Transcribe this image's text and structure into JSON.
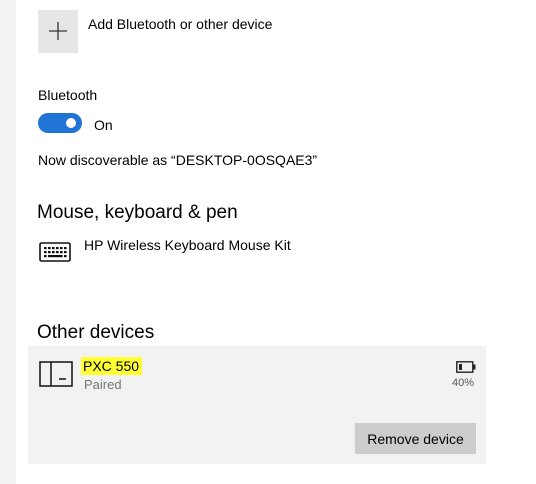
{
  "add_device": {
    "label": "Add Bluetooth or other device",
    "icon": "plus-icon"
  },
  "bluetooth": {
    "heading": "Bluetooth",
    "toggle_state": "On",
    "toggle_on": true,
    "discoverable_text": "Now discoverable as “DESKTOP-0OSQAE3”"
  },
  "mouse_keyboard_pen": {
    "title": "Mouse, keyboard & pen",
    "devices": [
      {
        "name": "HP Wireless Keyboard Mouse Kit",
        "icon": "keyboard-icon"
      }
    ]
  },
  "other_devices": {
    "title": "Other devices",
    "devices": [
      {
        "name": "PXC 550",
        "status": "Paired",
        "icon": "device-icon",
        "battery_icon": "battery-icon",
        "battery": "40%",
        "remove_label": "Remove device"
      }
    ]
  },
  "colors": {
    "accent": "#1f74d6",
    "highlight": "#ffff33",
    "card_background": "#f2f2f2",
    "button_background": "#cccccc",
    "secondary_text": "#767676"
  }
}
